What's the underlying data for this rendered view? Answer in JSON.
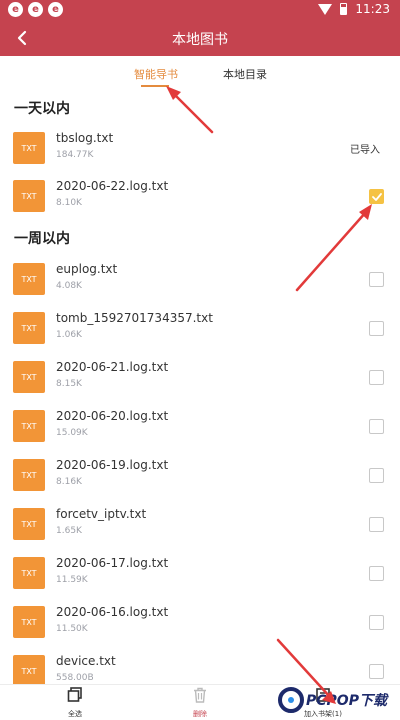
{
  "status_bar": {
    "time": "11:23",
    "notifications": [
      "e",
      "e",
      "e"
    ]
  },
  "header": {
    "title": "本地图书"
  },
  "tabs": [
    {
      "label": "智能导书",
      "active": true
    },
    {
      "label": "本地目录",
      "active": false
    }
  ],
  "sections": [
    {
      "title": "一天以内",
      "files": [
        {
          "name": "tbslog.txt",
          "size": "184.77K",
          "state": "imported",
          "status_text": "已导入"
        },
        {
          "name": "2020-06-22.log.txt",
          "size": "8.10K",
          "state": "checked"
        }
      ]
    },
    {
      "title": "一周以内",
      "files": [
        {
          "name": "euplog.txt",
          "size": "4.08K",
          "state": "unchecked"
        },
        {
          "name": "tomb_1592701734357.txt",
          "size": "1.06K",
          "state": "unchecked"
        },
        {
          "name": "2020-06-21.log.txt",
          "size": "8.15K",
          "state": "unchecked"
        },
        {
          "name": "2020-06-20.log.txt",
          "size": "15.09K",
          "state": "unchecked"
        },
        {
          "name": "2020-06-19.log.txt",
          "size": "8.16K",
          "state": "unchecked"
        },
        {
          "name": "forcetv_iptv.txt",
          "size": "1.65K",
          "state": "unchecked"
        },
        {
          "name": "2020-06-17.log.txt",
          "size": "11.59K",
          "state": "unchecked"
        },
        {
          "name": "2020-06-16.log.txt",
          "size": "11.50K",
          "state": "unchecked"
        },
        {
          "name": "device.txt",
          "size": "558.00B",
          "state": "unchecked"
        }
      ]
    }
  ],
  "file_icon_label": "TXT",
  "bottom_bar": {
    "select_all": "全选",
    "delete": "删除",
    "add_to_shelf": "加入书架(1)"
  },
  "watermark": {
    "text": "PCPOP下载"
  },
  "colors": {
    "header": "#c5434f",
    "accent": "#e48b3e",
    "file_icon": "#f29537",
    "checked": "#f5c243"
  }
}
